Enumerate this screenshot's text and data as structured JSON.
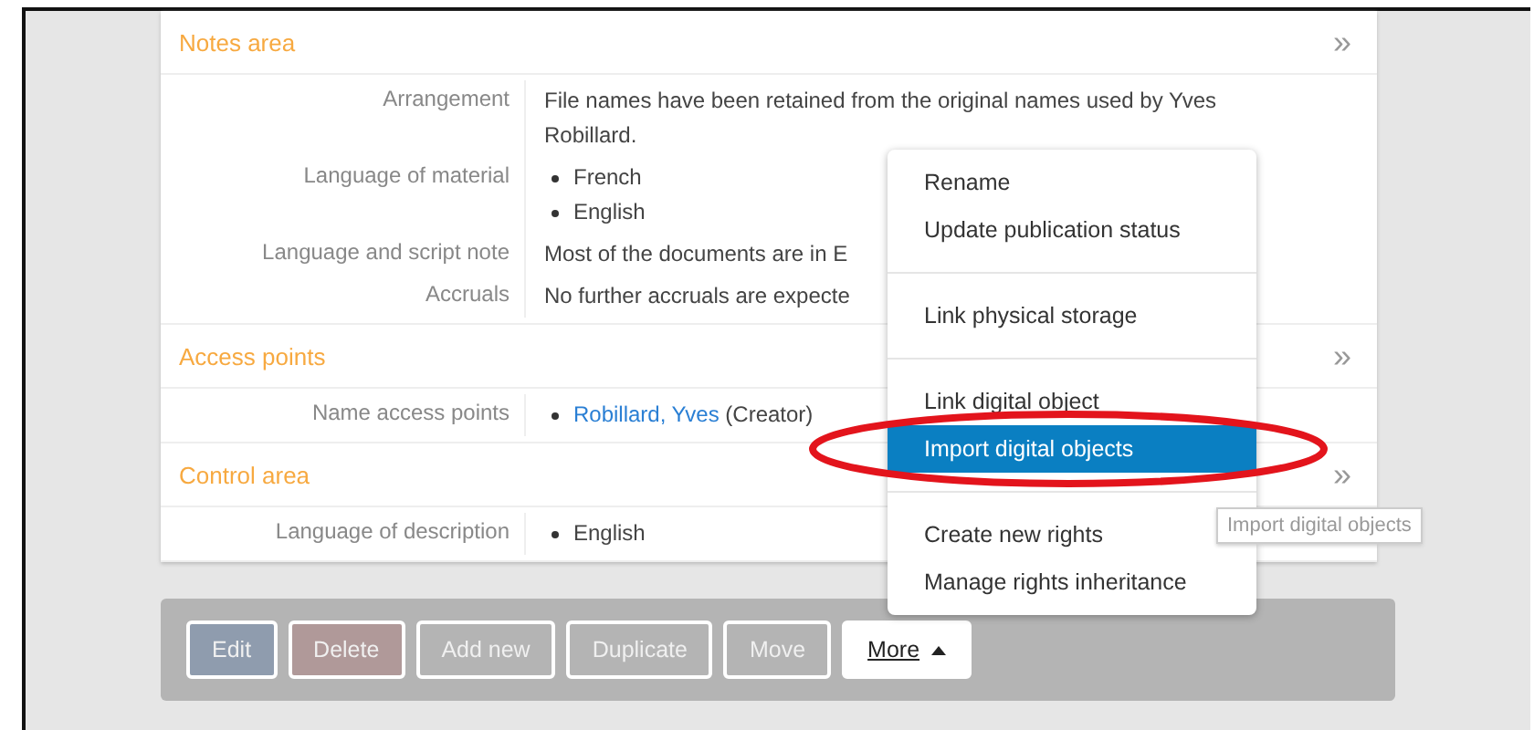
{
  "sections": [
    {
      "title": "Notes area",
      "rows": [
        {
          "label": "Arrangement",
          "kind": "text",
          "value": "File names have been retained from the original names used by Yves Robillard."
        },
        {
          "label": "Language of material",
          "kind": "list",
          "items": [
            "French",
            "English"
          ]
        },
        {
          "label": "Language and script note",
          "kind": "text",
          "value": "Most of the documents are in E"
        },
        {
          "label": "Accruals",
          "kind": "text",
          "value": "No further accruals are expecte"
        }
      ]
    },
    {
      "title": "Access points",
      "rows": [
        {
          "label": "Name access points",
          "kind": "link",
          "link": "Robillard, Yves",
          "suffix": "(Creator)"
        }
      ]
    },
    {
      "title": "Control area",
      "rows": [
        {
          "label": "Language of description",
          "kind": "list",
          "items": [
            "English"
          ]
        }
      ]
    }
  ],
  "section_toggle": "»",
  "actions": [
    {
      "label": "Edit",
      "kind": "edit"
    },
    {
      "label": "Delete",
      "kind": "delete"
    },
    {
      "label": "Add new",
      "kind": "plain"
    },
    {
      "label": "Duplicate",
      "kind": "plain"
    },
    {
      "label": "Move",
      "kind": "plain"
    },
    {
      "label": "More",
      "kind": "more"
    }
  ],
  "menu": [
    [
      {
        "label": "Rename",
        "selected": false
      },
      {
        "label": "Update publication status",
        "selected": false
      }
    ],
    [
      {
        "label": "Link physical storage",
        "selected": false
      }
    ],
    [
      {
        "label": "Link digital object",
        "selected": false
      },
      {
        "label": "Import digital objects",
        "selected": true
      }
    ],
    [
      {
        "label": "Create new rights",
        "selected": false
      },
      {
        "label": "Manage rights inheritance",
        "selected": false
      }
    ]
  ],
  "tooltip": "Import digital objects"
}
